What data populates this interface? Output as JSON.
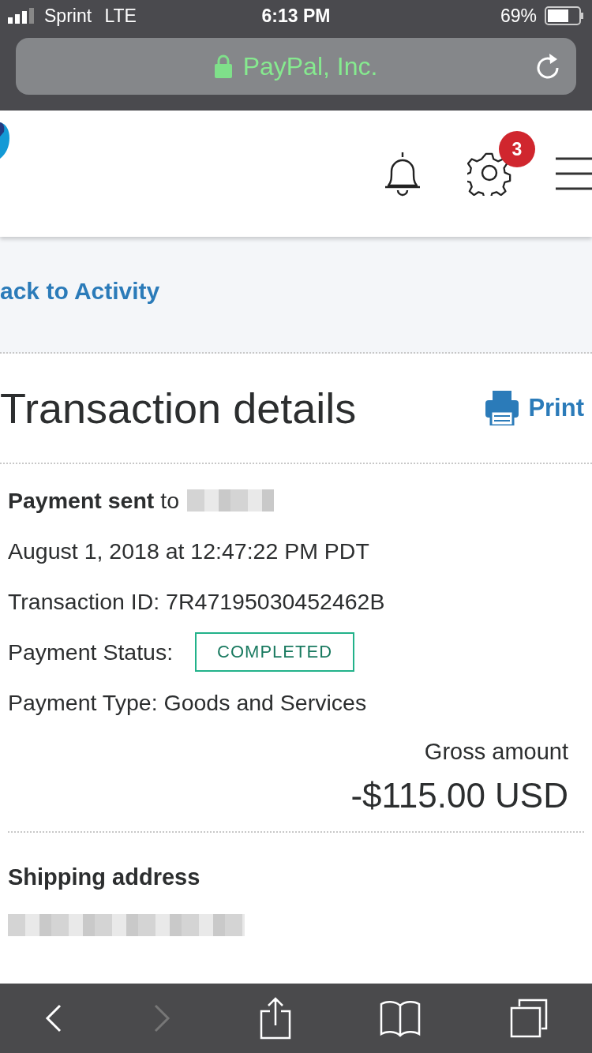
{
  "status_bar": {
    "carrier": "Sprint",
    "network": "LTE",
    "time": "6:13 PM",
    "battery_percent": "69%"
  },
  "url_bar": {
    "title": "PayPal, Inc."
  },
  "header": {
    "notification_badge": "3"
  },
  "back_link": "ack to Activity",
  "page": {
    "title": "Transaction details",
    "print": "Print"
  },
  "transaction": {
    "sent_label": "**Payment sent** to",
    "date": "August 1, 2018 at 12:47:22 PM PDT",
    "id": "Transaction ID: 7R47195030452462B",
    "status_label": "Payment Status:",
    "status": "COMPLETED",
    "type": "Payment Type: Goods and Services",
    "gross_label": "Gross amount",
    "gross_amount": "-$115.00 USD"
  },
  "shipping": {
    "heading": "Shipping address"
  },
  "toolbar": {
    "back_disabled": false,
    "forward_disabled": true
  }
}
